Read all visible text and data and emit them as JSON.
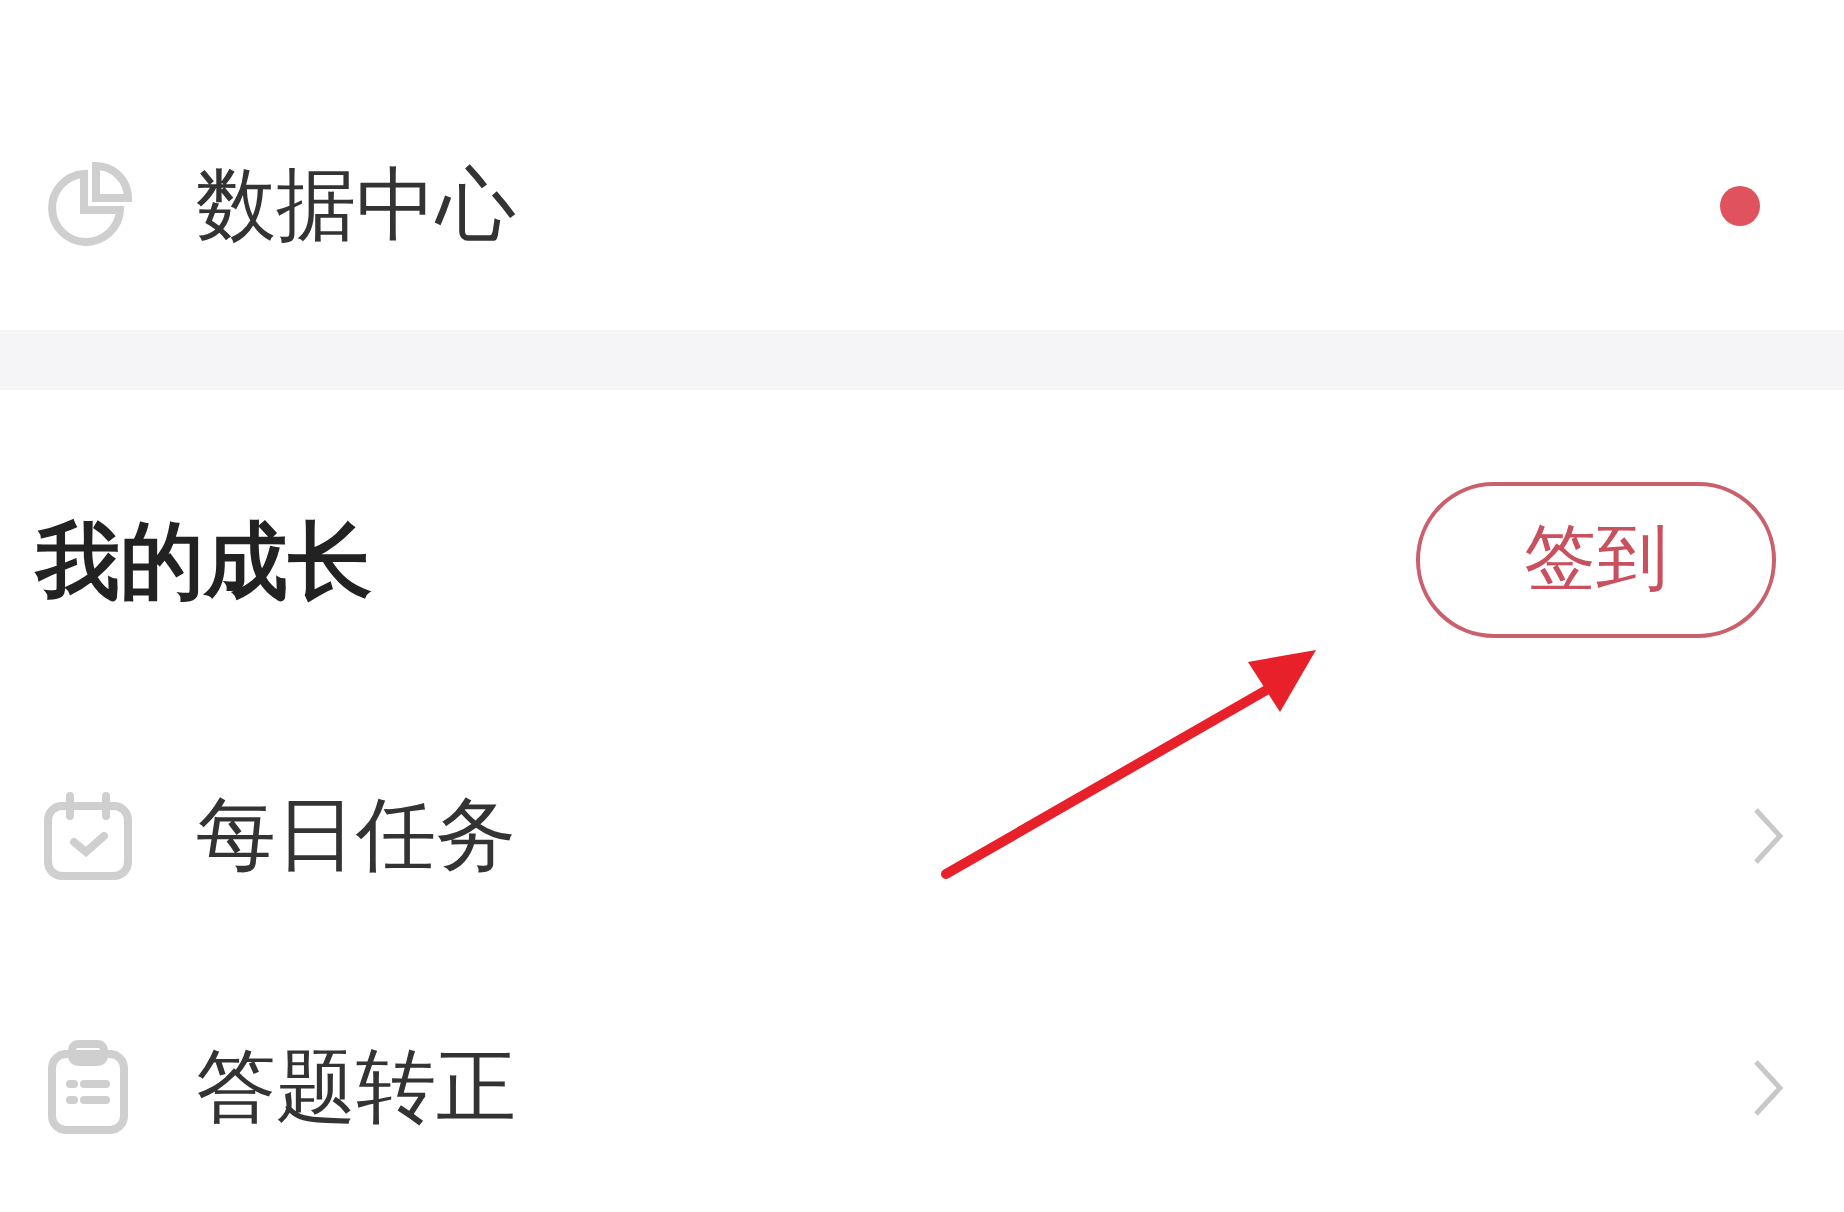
{
  "top_items": [
    {
      "label": "数据中心",
      "unread": true
    }
  ],
  "growth": {
    "title": "我的成长",
    "button": "签到",
    "items": [
      {
        "label": "每日任务"
      },
      {
        "label": "答题转正"
      }
    ]
  },
  "arrow_annotation": true
}
